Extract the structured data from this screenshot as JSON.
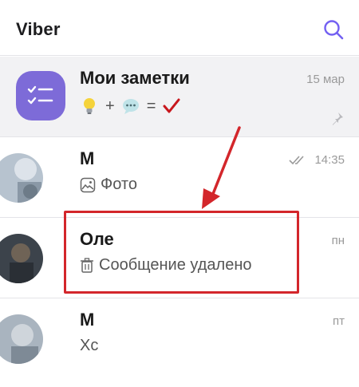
{
  "header": {
    "app_title": "Viber",
    "search_icon": "search-icon"
  },
  "colors": {
    "accent": "#7360f2",
    "notes_avatar": "#7d6bd8",
    "highlight": "#d3262b",
    "arrow": "#d3262b"
  },
  "chats": [
    {
      "name": "Мои заметки",
      "time": "15 мар",
      "preview_icons": [
        "lightbulb-emoji",
        "plus-sign",
        "speech-bubble-emoji",
        "equals-sign",
        "checkmark-emoji"
      ],
      "preview_plus": "+",
      "preview_equals": "=",
      "pinned": true
    },
    {
      "name": "М",
      "time": "14:35",
      "preview_icon": "photo-icon",
      "preview": "Фото",
      "status": "double-check-icon"
    },
    {
      "name": "Оле",
      "time": "пн",
      "preview_icon": "trash-icon",
      "preview": "Сообщение удалено"
    },
    {
      "name": "М",
      "time": "пт",
      "preview": "Хс"
    }
  ]
}
